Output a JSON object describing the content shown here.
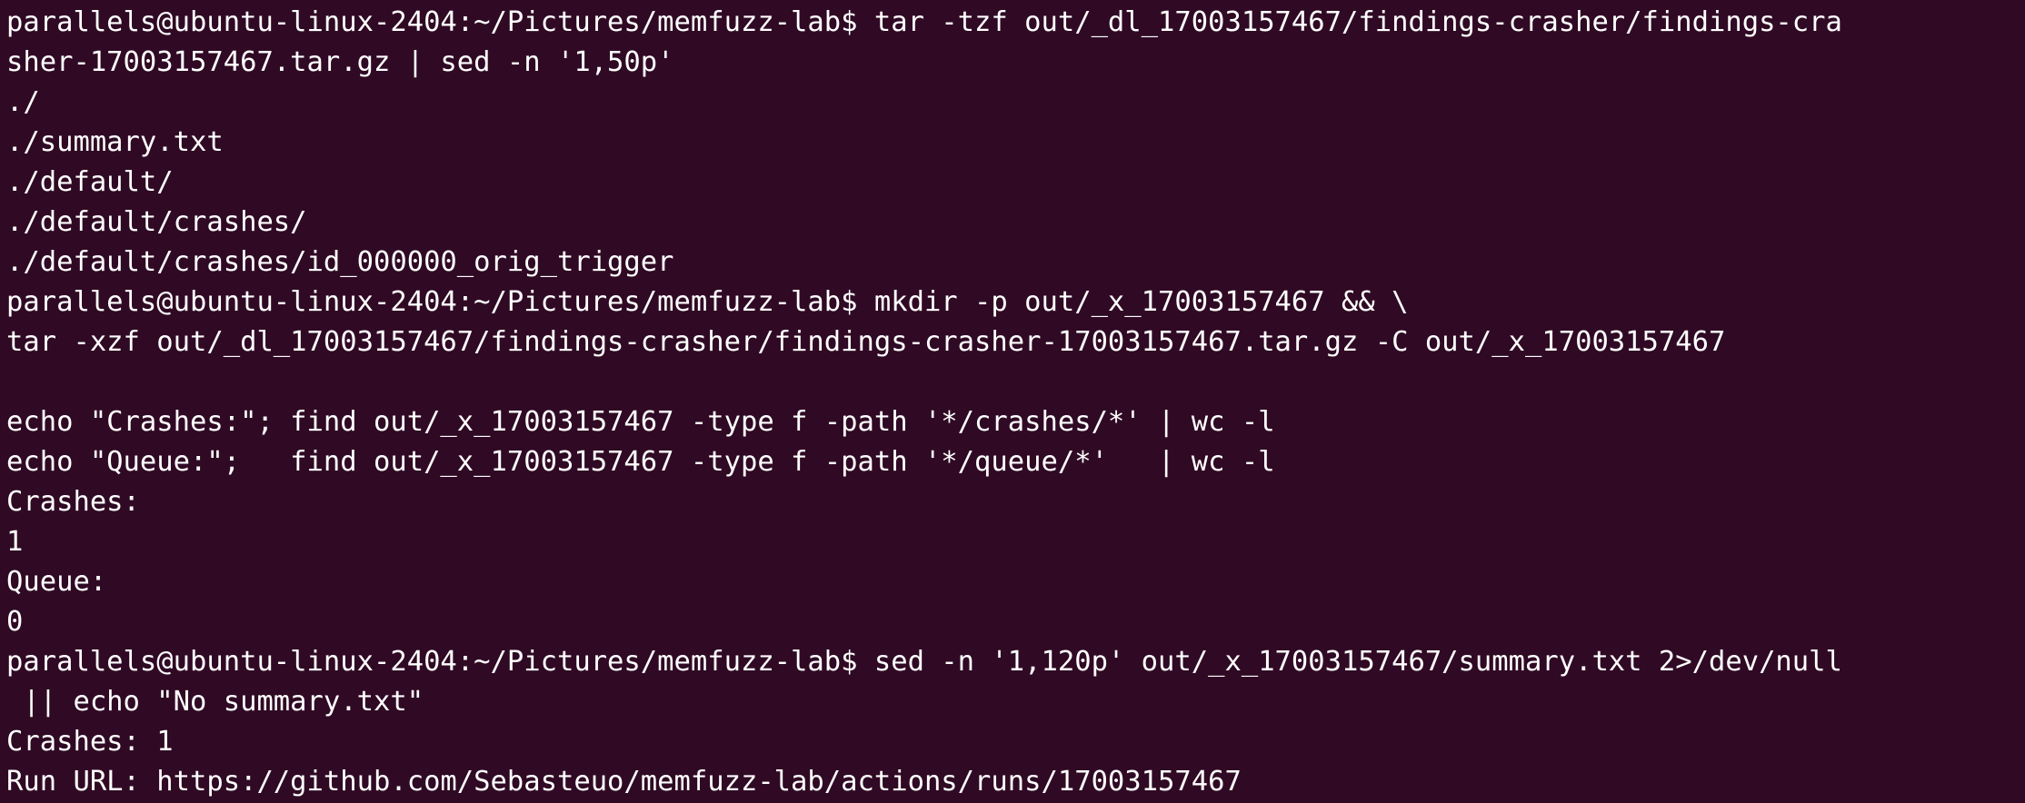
{
  "terminal": {
    "background": "#300a24",
    "foreground": "#ffffff",
    "lines": [
      "parallels@ubuntu-linux-2404:~/Pictures/memfuzz-lab$ tar -tzf out/_dl_17003157467/findings-crasher/findings-cra",
      "sher-17003157467.tar.gz | sed -n '1,50p'",
      "./",
      "./summary.txt",
      "./default/",
      "./default/crashes/",
      "./default/crashes/id_000000_orig_trigger",
      "parallels@ubuntu-linux-2404:~/Pictures/memfuzz-lab$ mkdir -p out/_x_17003157467 && \\",
      "tar -xzf out/_dl_17003157467/findings-crasher/findings-crasher-17003157467.tar.gz -C out/_x_17003157467",
      "",
      "echo \"Crashes:\"; find out/_x_17003157467 -type f -path '*/crashes/*' | wc -l",
      "echo \"Queue:\";   find out/_x_17003157467 -type f -path '*/queue/*'   | wc -l",
      "Crashes:",
      "1",
      "Queue:",
      "0",
      "parallels@ubuntu-linux-2404:~/Pictures/memfuzz-lab$ sed -n '1,120p' out/_x_17003157467/summary.txt 2>/dev/null",
      " || echo \"No summary.txt\"",
      "Crashes: 1",
      "Run URL: https://github.com/Sebasteuo/memfuzz-lab/actions/runs/17003157467"
    ]
  }
}
